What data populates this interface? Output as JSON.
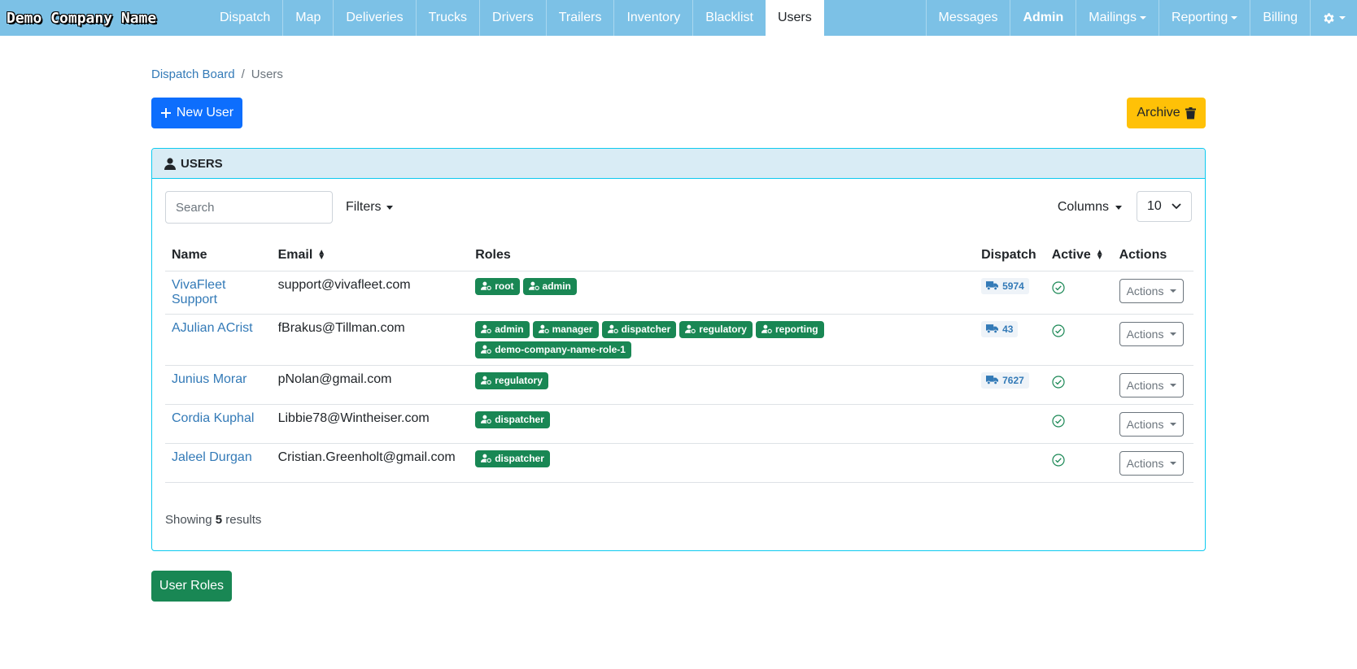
{
  "navbar": {
    "brand": "Demo Company Name",
    "left_items": [
      {
        "label": "Dispatch"
      },
      {
        "label": "Map"
      },
      {
        "label": "Deliveries"
      },
      {
        "label": "Trucks"
      },
      {
        "label": "Drivers"
      },
      {
        "label": "Trailers"
      },
      {
        "label": "Inventory"
      },
      {
        "label": "Blacklist"
      },
      {
        "label": "Users",
        "active": true
      }
    ],
    "right_items": [
      {
        "label": "Messages"
      },
      {
        "label": "Admin",
        "bold": true
      },
      {
        "label": "Mailings",
        "dropdown": true
      },
      {
        "label": "Reporting",
        "dropdown": true
      },
      {
        "label": "Billing"
      }
    ],
    "settings_icon": "gear-icon"
  },
  "breadcrumb": {
    "parent": "Dispatch Board",
    "separator": "/",
    "current": "Users"
  },
  "buttons": {
    "new_user": "New User",
    "archive": "Archive",
    "user_roles": "User Roles"
  },
  "card": {
    "title": "USERS"
  },
  "toolbar": {
    "search_placeholder": "Search",
    "filters": "Filters",
    "columns": "Columns",
    "page_size": "10"
  },
  "table": {
    "headers": {
      "name": "Name",
      "email": "Email",
      "roles": "Roles",
      "dispatch": "Dispatch",
      "active": "Active",
      "actions": "Actions"
    },
    "rows": [
      {
        "name": "VivaFleet Support",
        "email": "support@vivafleet.com",
        "roles": [
          "root",
          "admin"
        ],
        "dispatch": "5974",
        "active": true,
        "actions": "Actions"
      },
      {
        "name": "AJulian ACrist",
        "email": "fBrakus@Tillman.com",
        "roles": [
          "admin",
          "manager",
          "dispatcher",
          "regulatory",
          "reporting",
          "demo-company-name-role-1"
        ],
        "dispatch": "43",
        "active": true,
        "actions": "Actions"
      },
      {
        "name": "Junius Morar",
        "email": "pNolan@gmail.com",
        "roles": [
          "regulatory"
        ],
        "dispatch": "7627",
        "active": true,
        "actions": "Actions"
      },
      {
        "name": "Cordia Kuphal",
        "email": "Libbie78@Wintheiser.com",
        "roles": [
          "dispatcher"
        ],
        "dispatch": "",
        "active": true,
        "actions": "Actions"
      },
      {
        "name": "Jaleel Durgan",
        "email": "Cristian.Greenholt@gmail.com",
        "roles": [
          "dispatcher"
        ],
        "dispatch": "",
        "active": true,
        "actions": "Actions"
      }
    ]
  },
  "footer": {
    "showing_prefix": "Showing",
    "count": "5",
    "showing_suffix": "results"
  },
  "colors": {
    "navbar": "#7cc1e6",
    "primary": "#0d6efd",
    "warning": "#ffc107",
    "success": "#198754",
    "info_border": "#0dcaf0",
    "link": "#337ab7"
  }
}
